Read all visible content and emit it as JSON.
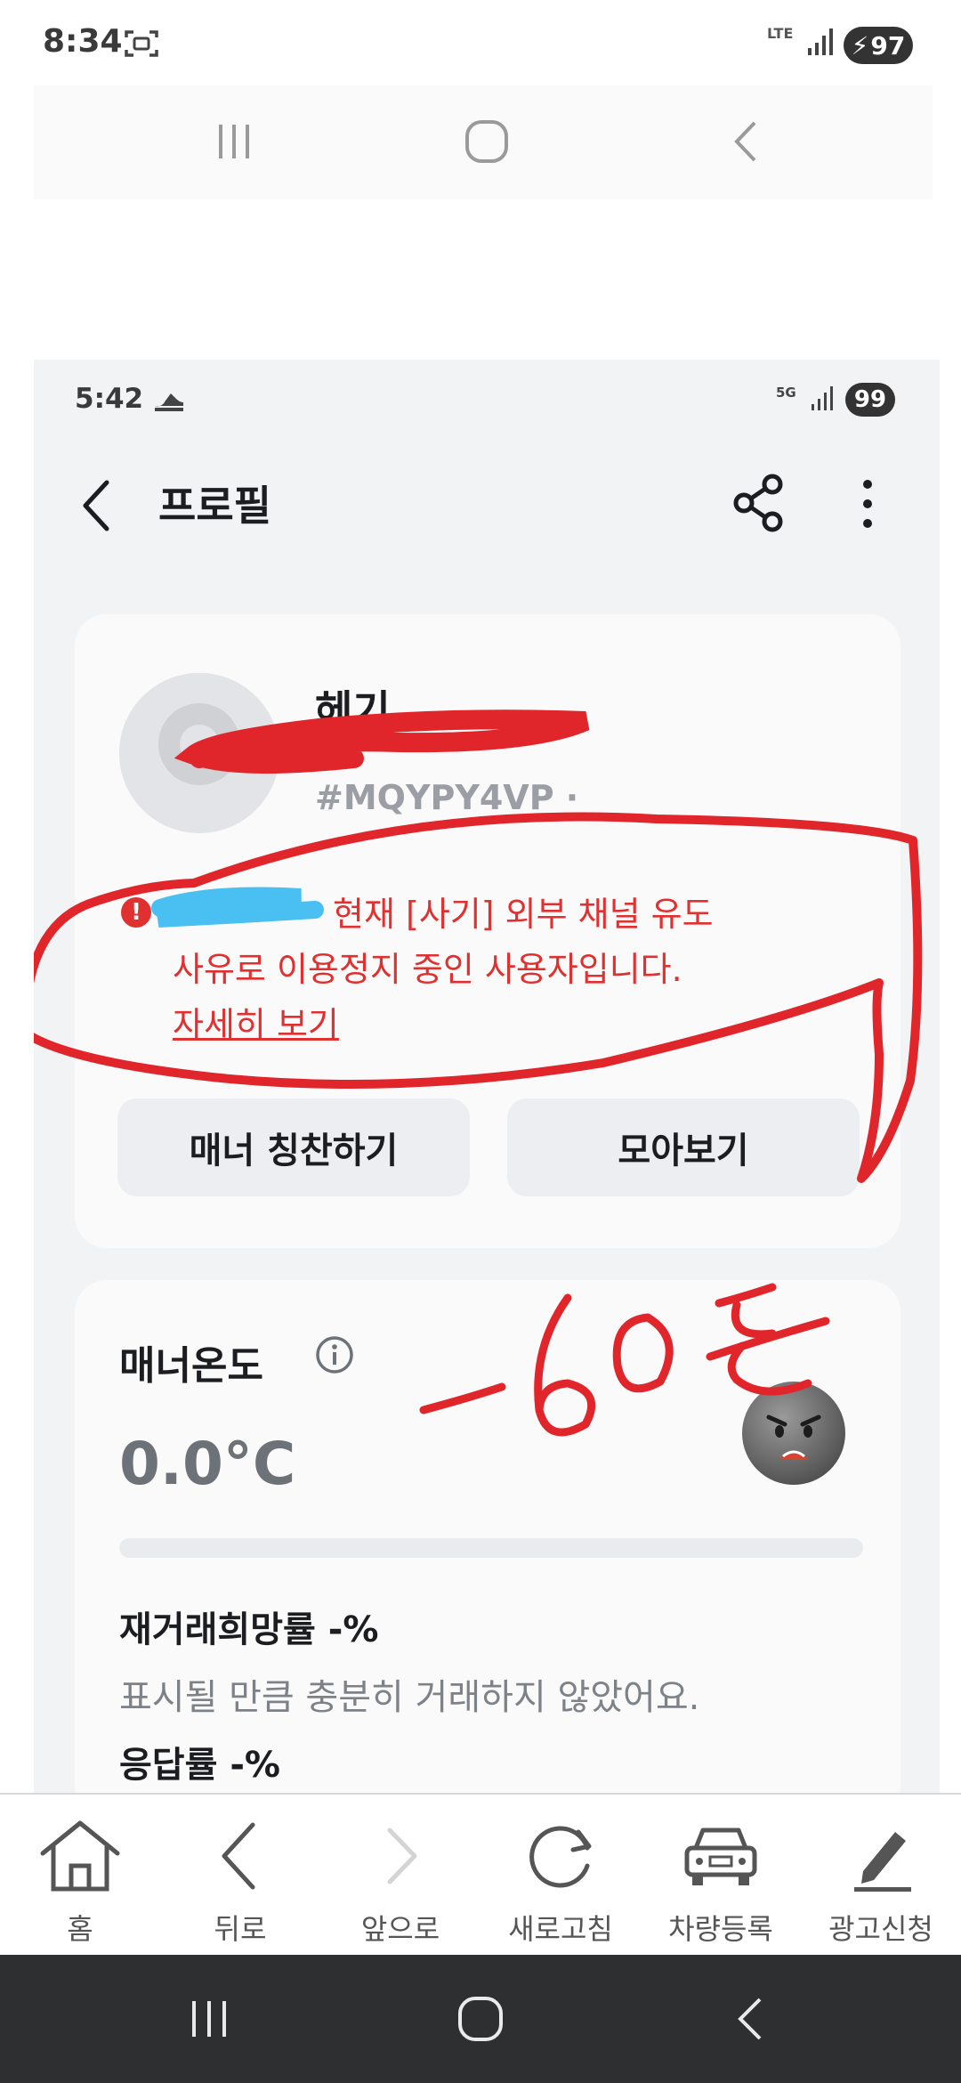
{
  "outer_status": {
    "time": "8:34",
    "network": "LTE",
    "battery": "97",
    "battery_glyph": "⚡"
  },
  "inner_status": {
    "time": "5:42",
    "network": "5G",
    "battery": "99"
  },
  "header": {
    "title": "프로필",
    "back_icon": "chevron-left-icon",
    "share_icon": "share-icon",
    "more_icon": "more-vertical-icon"
  },
  "profile": {
    "nickname": "헤기",
    "user_id": "#MQYPY4VP ·",
    "warning_line1": "현재 [사기] 외부 채널 유도",
    "warning_line2": "사유로 이용정지 중인 사용자입니다.",
    "warning_more": "자세히 보기",
    "praise_button": "매너 칭찬하기",
    "collect_button": "모아보기"
  },
  "manner": {
    "label": "매너온도",
    "temperature": "0.0°C",
    "temperature_value": 0.0,
    "rehire_rate": "재거래희망률 -%",
    "rehire_desc": "표시될 만큼 충분히 거래하지 않았어요.",
    "response_rate": "응답률 -%"
  },
  "annotation": {
    "handwritten_text": "-60도",
    "color": "#e0262a"
  },
  "toolbar": {
    "items": [
      {
        "label": "홈",
        "icon": "home-icon"
      },
      {
        "label": "뒤로",
        "icon": "back-icon"
      },
      {
        "label": "앞으로",
        "icon": "forward-icon"
      },
      {
        "label": "새로고침",
        "icon": "refresh-icon"
      },
      {
        "label": "차량등록",
        "icon": "car-icon"
      },
      {
        "label": "광고신청",
        "icon": "pencil-icon"
      }
    ]
  },
  "colors": {
    "warning_red": "#e0302f",
    "card_bg": "#fafafa",
    "page_bg": "#f2f3f5"
  }
}
